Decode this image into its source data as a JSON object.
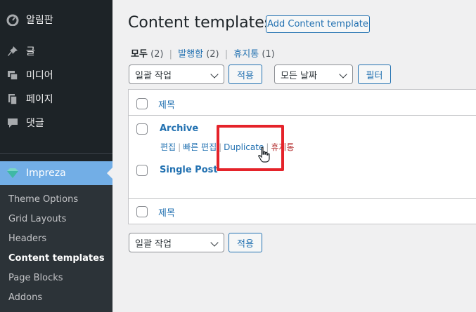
{
  "sidebar": {
    "items": [
      {
        "label": "알림판",
        "icon": "dashboard-icon"
      },
      {
        "label": "글",
        "icon": "pin-icon"
      },
      {
        "label": "미디어",
        "icon": "media-icon"
      },
      {
        "label": "페이지",
        "icon": "pages-icon"
      },
      {
        "label": "댓글",
        "icon": "comment-icon"
      }
    ],
    "active": {
      "label": "Impreza",
      "icon": "impreza-gem-icon"
    },
    "submenu": [
      {
        "label": "Theme Options"
      },
      {
        "label": "Grid Layouts"
      },
      {
        "label": "Headers"
      },
      {
        "label": "Content templates"
      },
      {
        "label": "Page Blocks"
      },
      {
        "label": "Addons"
      }
    ]
  },
  "page": {
    "title": "Content templates",
    "add_button": "Add Content template"
  },
  "filters": {
    "all_label": "모두",
    "all_count": "(2)",
    "published_label": "발행함",
    "published_count": "(2)",
    "trash_label": "휴지통",
    "trash_count": "(1)",
    "separator": "|"
  },
  "toolbar_top": {
    "bulk_action": "일괄 작업",
    "apply": "적용",
    "date_filter": "모든 날짜",
    "filter_button": "필터"
  },
  "table": {
    "column_title": "제목",
    "rows": [
      {
        "title": "Archive"
      },
      {
        "title": "Single Post"
      }
    ],
    "row_actions": {
      "edit": "편집",
      "quick_edit": "빠른 편집",
      "duplicate": "Duplicate",
      "trash": "휴지통",
      "separator": "|"
    }
  },
  "toolbar_bottom": {
    "bulk_action": "일괄 작업",
    "apply": "적용"
  },
  "colors": {
    "sidebar_bg": "#1d2327",
    "active_bg": "#72aee6",
    "link": "#2271b1",
    "trash": "#b32d2e",
    "highlight": "#e5232a"
  }
}
